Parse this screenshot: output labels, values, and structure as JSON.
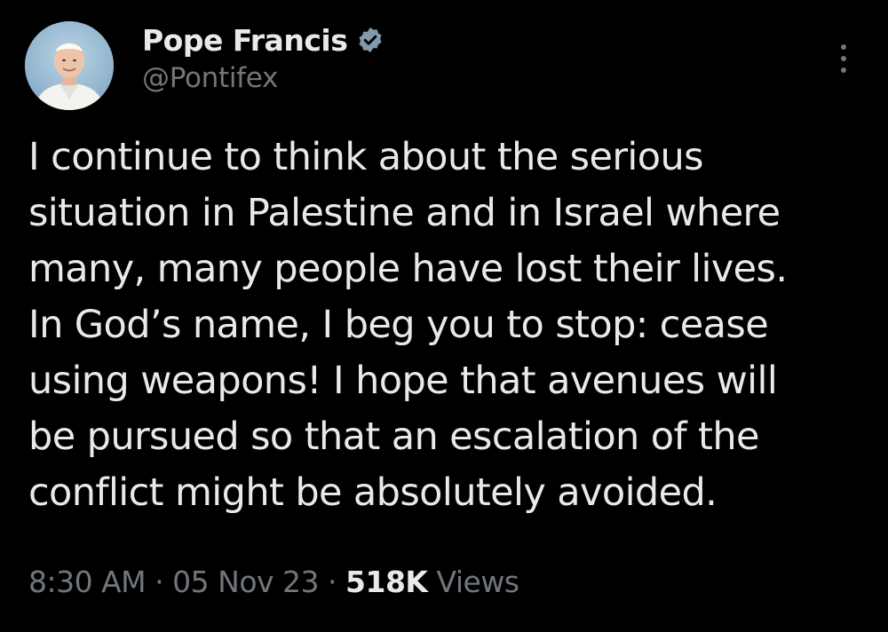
{
  "tweet": {
    "author": {
      "display_name": "Pope Francis",
      "handle": "@Pontifex",
      "verified": true,
      "avatar_icon": "profile-photo"
    },
    "more_icon": "more-options-icon",
    "text_lines": [
      "I continue to think about the serious",
      "situation in Palestine and in Israel where",
      "many, many people have lost their lives.",
      "In God’s name, I beg you to stop: cease",
      "using weapons! I hope that avenues will",
      "be pursued so that an escalation of the",
      "conflict might be absolutely avoided."
    ],
    "meta": {
      "time": "8:30 AM",
      "separator": "·",
      "date": "05 Nov 23",
      "views_count": "518K",
      "views_label": "Views"
    }
  },
  "colors": {
    "background": "#000000",
    "text_primary": "#e7e9ea",
    "text_secondary": "#71767b",
    "verified_badge": "#829aab"
  }
}
